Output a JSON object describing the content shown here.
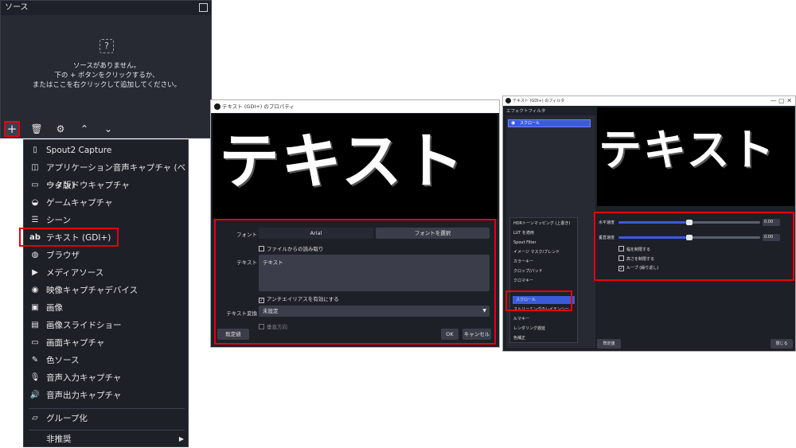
{
  "sources": {
    "title": "ソース",
    "empty_line1": "ソースがありません。",
    "empty_line2": "下の + ボタンをクリックするか、",
    "empty_line3": "またはここを右クリックして追加してください。",
    "icons": [
      "plus-icon",
      "trash-icon",
      "gear-icon",
      "chevron-up-icon",
      "chevron-down-icon"
    ]
  },
  "menu": {
    "items": [
      {
        "label": "Spout2 Capture",
        "icon": "file-icon"
      },
      {
        "label": "アプリケーション音声キャプチャ (ベータ版)",
        "icon": "app-audio-icon"
      },
      {
        "label": "ウィンドウキャプチャ",
        "icon": "window-icon"
      },
      {
        "label": "ゲームキャプチャ",
        "icon": "gamepad-icon"
      },
      {
        "label": "シーン",
        "icon": "list-icon"
      },
      {
        "label": "テキスト (GDI+)",
        "icon": "text-ab-icon"
      },
      {
        "label": "ブラウザ",
        "icon": "globe-icon"
      },
      {
        "label": "メディアソース",
        "icon": "play-icon"
      },
      {
        "label": "映像キャプチャデバイス",
        "icon": "camera-icon"
      },
      {
        "label": "画像",
        "icon": "image-icon"
      },
      {
        "label": "画像スライドショー",
        "icon": "slideshow-icon"
      },
      {
        "label": "画面キャプチャ",
        "icon": "monitor-icon"
      },
      {
        "label": "色ソース",
        "icon": "brush-icon"
      },
      {
        "label": "音声入力キャプチャ",
        "icon": "microphone-icon"
      },
      {
        "label": "音声出力キャプチャ",
        "icon": "speaker-icon"
      }
    ],
    "group": "グループ化",
    "deprecated": "非推奨"
  },
  "props": {
    "title": "テキスト (GDI+) のプロパティ",
    "preview_text": "テキスト",
    "font_label": "フォント",
    "font_value": "Arial",
    "font_button": "フォントを選択",
    "from_file": "ファイルからの読み取り",
    "text_label": "テキスト",
    "text_value": "テキスト",
    "antialias": "アンチエイリアスを有効にする",
    "transform_label": "テキスト変換",
    "transform_value": "未設定",
    "cut_text": "垂直方向",
    "defaults": "既定値",
    "ok": "OK",
    "cancel": "キャンセル"
  },
  "filters": {
    "title": "テキスト (GDI+) のフィルタ",
    "effect_filters": "エフェクトフィルタ",
    "active_filter": "スクロール",
    "preview_text": "テキスト",
    "menu_items": [
      "HDRトーンマッピング (上書き)",
      "LUT を適用",
      "Spout Filter",
      "イメージ マスク/ブレンド",
      "カラーキー",
      "クロップ/パッド",
      "クロマキー"
    ],
    "scroll_item": "スクロール",
    "menu_items_after": [
      "ストリーミングのレイテンシー",
      "ルマキー",
      "レンダリング遅延",
      "色補正"
    ],
    "h_speed_label": "水平速度",
    "h_speed_value": "0.00",
    "v_speed_label": "垂直速度",
    "v_speed_value": "0.00",
    "limit_width": "幅を制限する",
    "limit_height": "高さを制限する",
    "loop": "ループ (繰り返し)",
    "defaults": "既定値",
    "close": "閉じる"
  },
  "colors": {
    "highlight": "#e8000d",
    "accent": "#3c5bd8"
  }
}
